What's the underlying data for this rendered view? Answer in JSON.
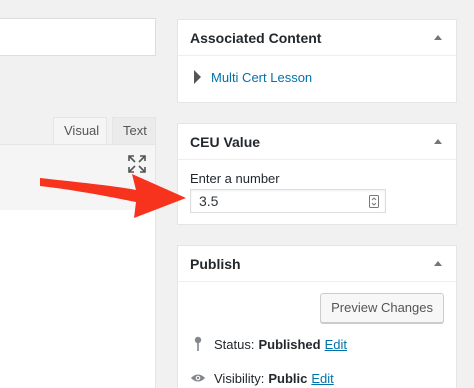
{
  "editor": {
    "tabs": [
      {
        "label": "Visual"
      },
      {
        "label": "Text"
      }
    ],
    "expand_icon": "fullscreen-expand-icon"
  },
  "annotation": {
    "arrow_color": "#f7331e",
    "icon": "red-pointer-arrow"
  },
  "associated_content": {
    "title": "Associated Content",
    "items": [
      {
        "label": "Multi Cert Lesson"
      }
    ]
  },
  "ceu_value": {
    "title": "CEU Value",
    "field_label": "Enter a number",
    "field_value": "3.5"
  },
  "publish": {
    "title": "Publish",
    "preview_label": "Preview Changes",
    "status_label": "Status:",
    "status_value": "Published",
    "status_edit": "Edit",
    "visibility_label": "Visibility:",
    "visibility_value": "Public",
    "visibility_edit": "Edit"
  },
  "colors": {
    "link": "#0073aa",
    "background": "#f1f1f1"
  }
}
